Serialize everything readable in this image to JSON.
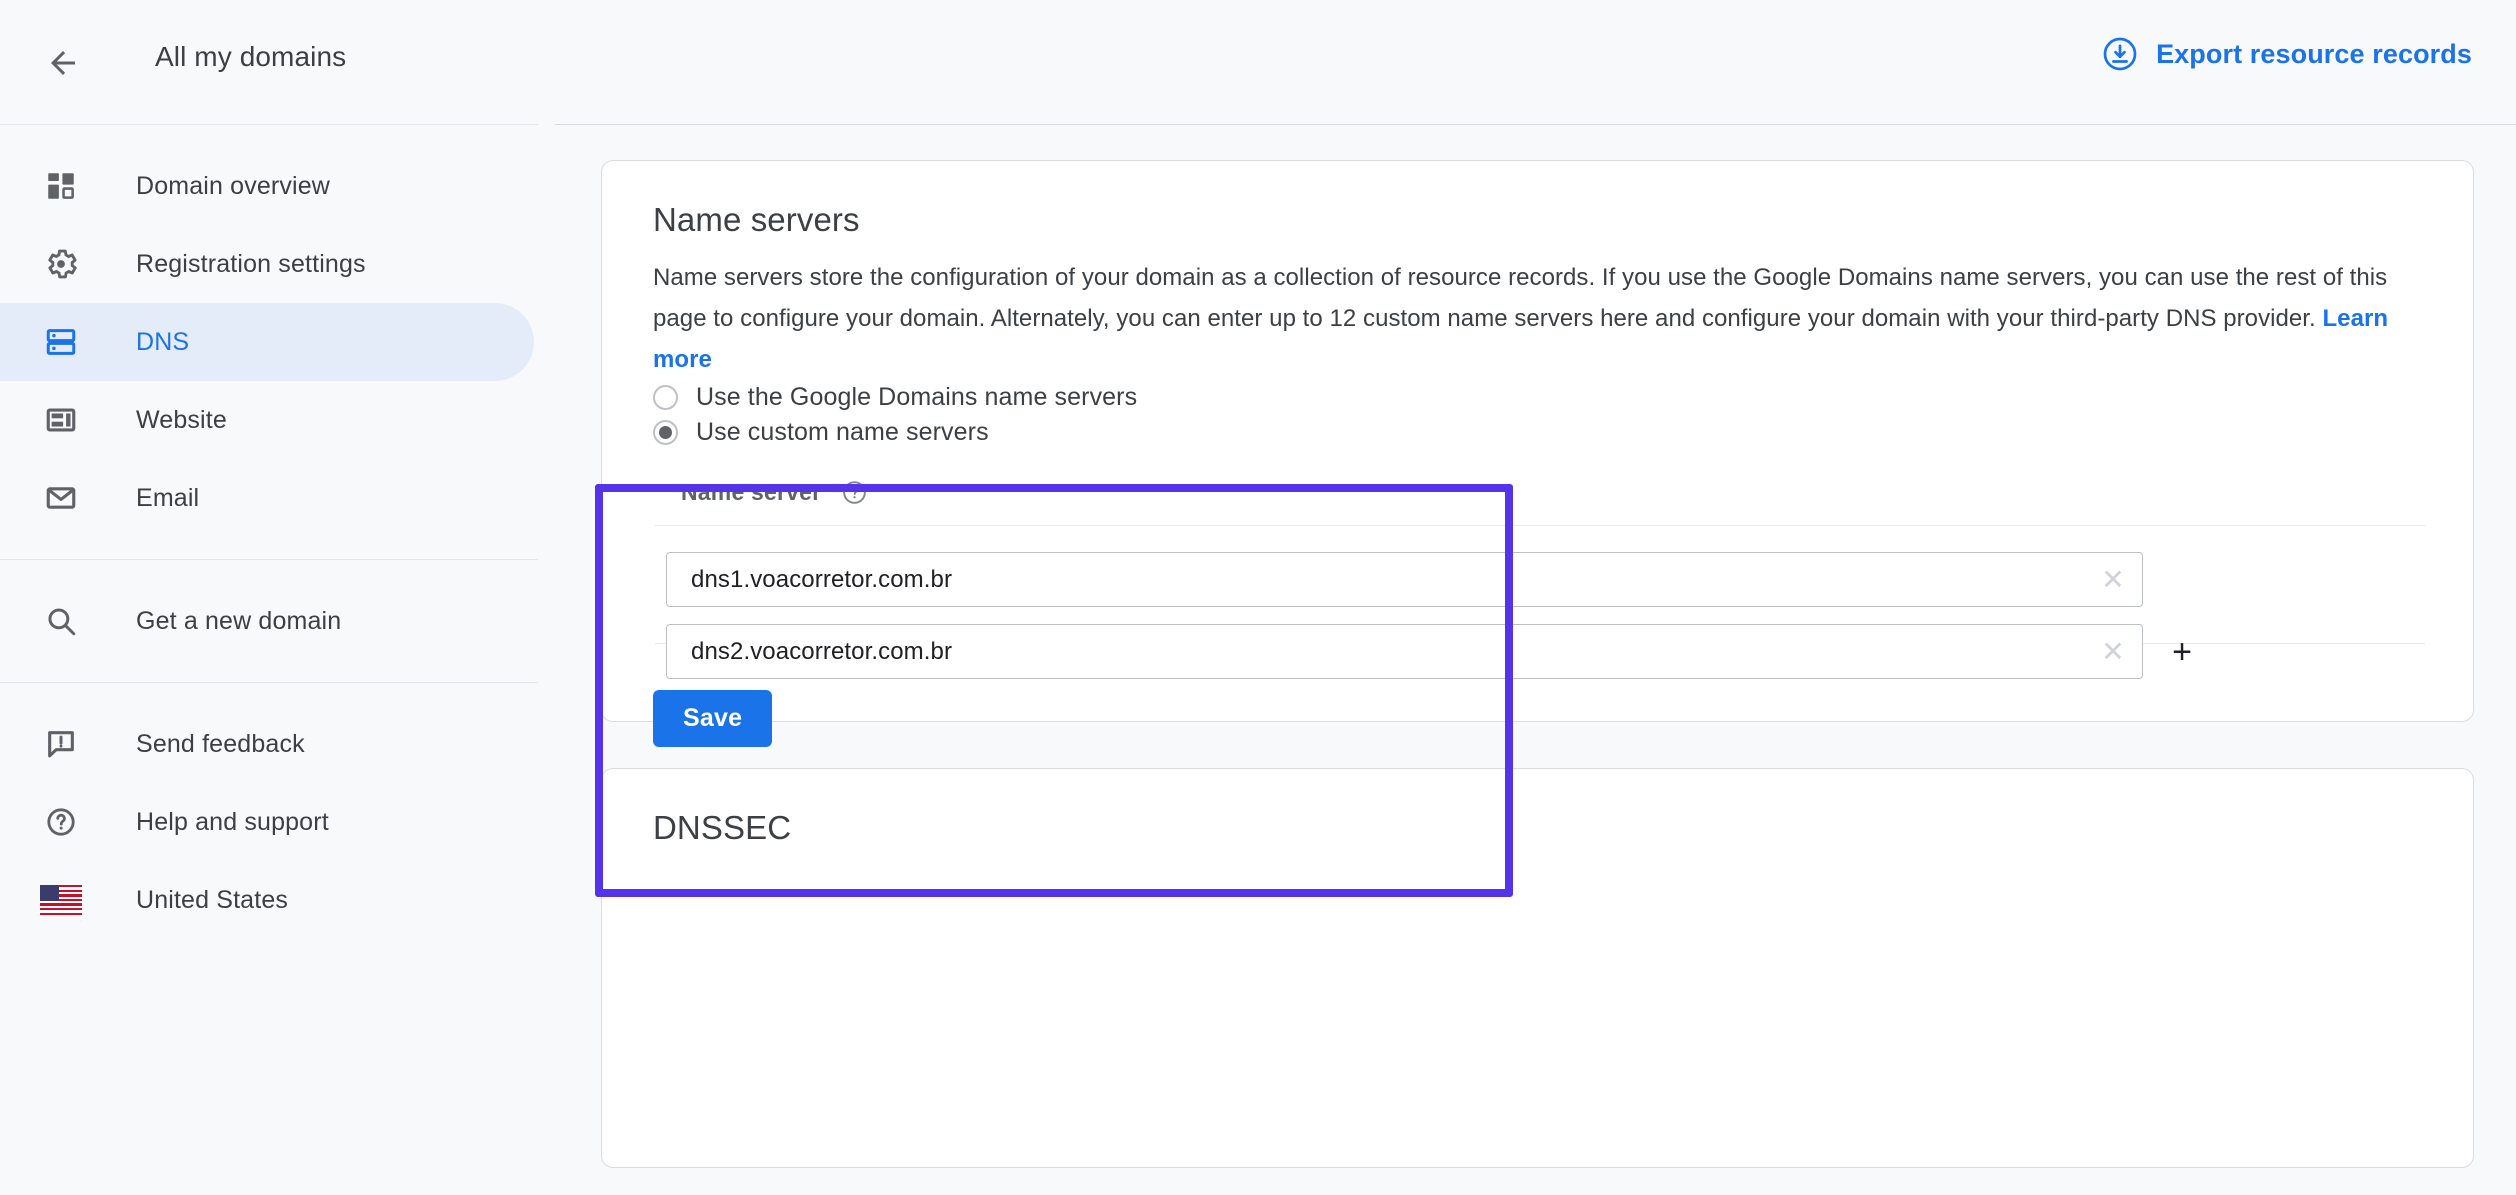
{
  "topbar": {
    "back_icon": "back-arrow-icon",
    "title": "All my domains",
    "export_icon": "download-circle-icon",
    "export_label": "Export resource records",
    "link_color": "#1a73e8"
  },
  "sidebar": {
    "items": [
      {
        "icon": "dashboard-icon",
        "label": "Domain overview",
        "active": false
      },
      {
        "icon": "gear-icon",
        "label": "Registration settings",
        "active": false
      },
      {
        "icon": "dns-server-icon",
        "label": "DNS",
        "active": true
      },
      {
        "icon": "website-layout-icon",
        "label": "Website",
        "active": false
      },
      {
        "icon": "envelope-icon",
        "label": "Email",
        "active": false
      }
    ],
    "items_group2": [
      {
        "icon": "search-icon",
        "label": "Get a new domain"
      }
    ],
    "items_group3": [
      {
        "icon": "feedback-icon",
        "label": "Send feedback"
      },
      {
        "icon": "help-circle-icon",
        "label": "Help and support"
      },
      {
        "icon": "us-flag-icon",
        "label": "United States"
      }
    ],
    "active_color": "#1a73e8",
    "active_bg": "#e4ecfa"
  },
  "name_servers_card": {
    "heading": "Name servers",
    "description_part1": "Name servers store the configuration of your domain as a collection of resource records. If you use the Google Domains name servers, you can use the rest of this page to configure your domain. Alternately, you can enter up to 12 custom name servers here and configure your domain with your third-party DNS provider. ",
    "learn_more": "Learn more",
    "radio_google": "Use the Google Domains name servers",
    "radio_custom": "Use custom name servers",
    "selected_option": "Use custom name servers",
    "table_header": "Name server",
    "help_icon": "help-circle-icon",
    "rows": [
      {
        "value": "dns1.voacorretor.com.br",
        "clear_icon": "close-icon",
        "has_add": false
      },
      {
        "value": "dns2.voacorretor.com.br",
        "clear_icon": "close-icon",
        "has_add": true,
        "add_icon": "plus-icon"
      }
    ],
    "save_label": "Save",
    "save_color": "#1a73e8"
  },
  "dnssec_card": {
    "heading": "DNSSEC"
  },
  "annotation": {
    "highlight_color": "#5433eb",
    "target": "custom-name-servers-section"
  }
}
